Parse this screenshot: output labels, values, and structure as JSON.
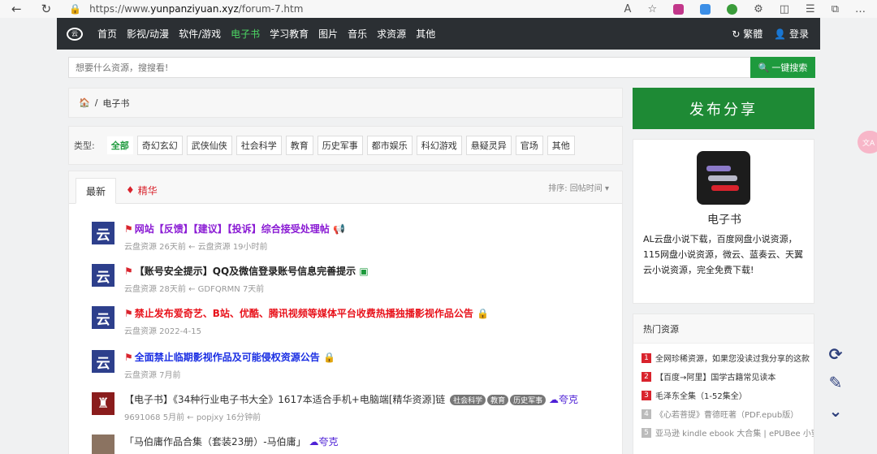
{
  "browser": {
    "url_prefix": "https://www.",
    "url_domain": "yunpanziyuan.xyz",
    "url_path": "/forum-7.htm"
  },
  "nav": {
    "items": [
      "首页",
      "影视/动漫",
      "软件/游戏",
      "电子书",
      "学习教育",
      "图片",
      "音乐",
      "求资源",
      "其他"
    ],
    "traditional": "繁體",
    "login": "登录"
  },
  "search": {
    "placeholder": "想要什么资源，搜搜看!",
    "button": "一键搜索"
  },
  "breadcrumb": {
    "current": "电子书"
  },
  "types": {
    "label": "类型:",
    "items": [
      "全部",
      "奇幻玄幻",
      "武侠仙侠",
      "社会科学",
      "教育",
      "历史军事",
      "都市娱乐",
      "科幻游戏",
      "悬疑灵异",
      "官场",
      "其他"
    ]
  },
  "tabs": {
    "latest": "最新",
    "best": "精华",
    "sort": "排序: 回帖时间"
  },
  "threads": [
    {
      "avatar": "云",
      "title": "网站【反馈】【建议】【投诉】综合接受处理帖",
      "meta": "云盘资源  26天前  ←  云盘资源  19小时前"
    },
    {
      "avatar": "云",
      "title": "【账号安全提示】QQ及微信登录账号信息完善提示",
      "meta": "云盘资源  28天前  ←  GDFQRMN  7天前"
    },
    {
      "avatar": "云",
      "title": "禁止发布爱奇艺、B站、优酷、腾讯视频等媒体平台收费热播独播影视作品公告",
      "meta": "云盘资源  2022-4-15"
    },
    {
      "avatar": "云",
      "title": "全面禁止临期影视作品及可能侵权资源公告",
      "meta": "云盘资源  7月前"
    },
    {
      "title": "【电子书】《34种行业电子书大全》1617本适合手机+电脑端[精华资源]链",
      "tags": [
        "社会科学",
        "教育",
        "历史军事"
      ],
      "qk": "夸克",
      "meta": "9691068  5月前  ←  popjxy  16分钟前"
    },
    {
      "title": "「马伯庸作品合集（套装23册）-马伯庸」",
      "qk": "夸克",
      "meta": ""
    }
  ],
  "sidebar": {
    "publish": "发布分享",
    "forum_name": "电子书",
    "forum_desc": "AL云盘小说下载，百度网盘小说资源，115网盘小说资源，微云、蓝奏云、天翼云小说资源，完全免费下载!",
    "hot_title": "热门资源",
    "hot": [
      {
        "n": "1",
        "text": "全网珍稀资源，如果您没读过我分享的这款"
      },
      {
        "n": "2",
        "text": "【百度→阿里】国学古籍常见读本"
      },
      {
        "n": "3",
        "text": "毛泽东全集（1-52集全）"
      },
      {
        "n": "4",
        "text": "《心若菩提》曹德旺著（PDF.epub版）"
      },
      {
        "n": "5",
        "text": "亚马逊 kindle ebook 大合集 | ePUBee 小蜜"
      }
    ]
  },
  "colors": {
    "nav_bg": "#2b2f33",
    "accent": "#1e9a3d",
    "avatar_blue": "#2d3f8c"
  }
}
